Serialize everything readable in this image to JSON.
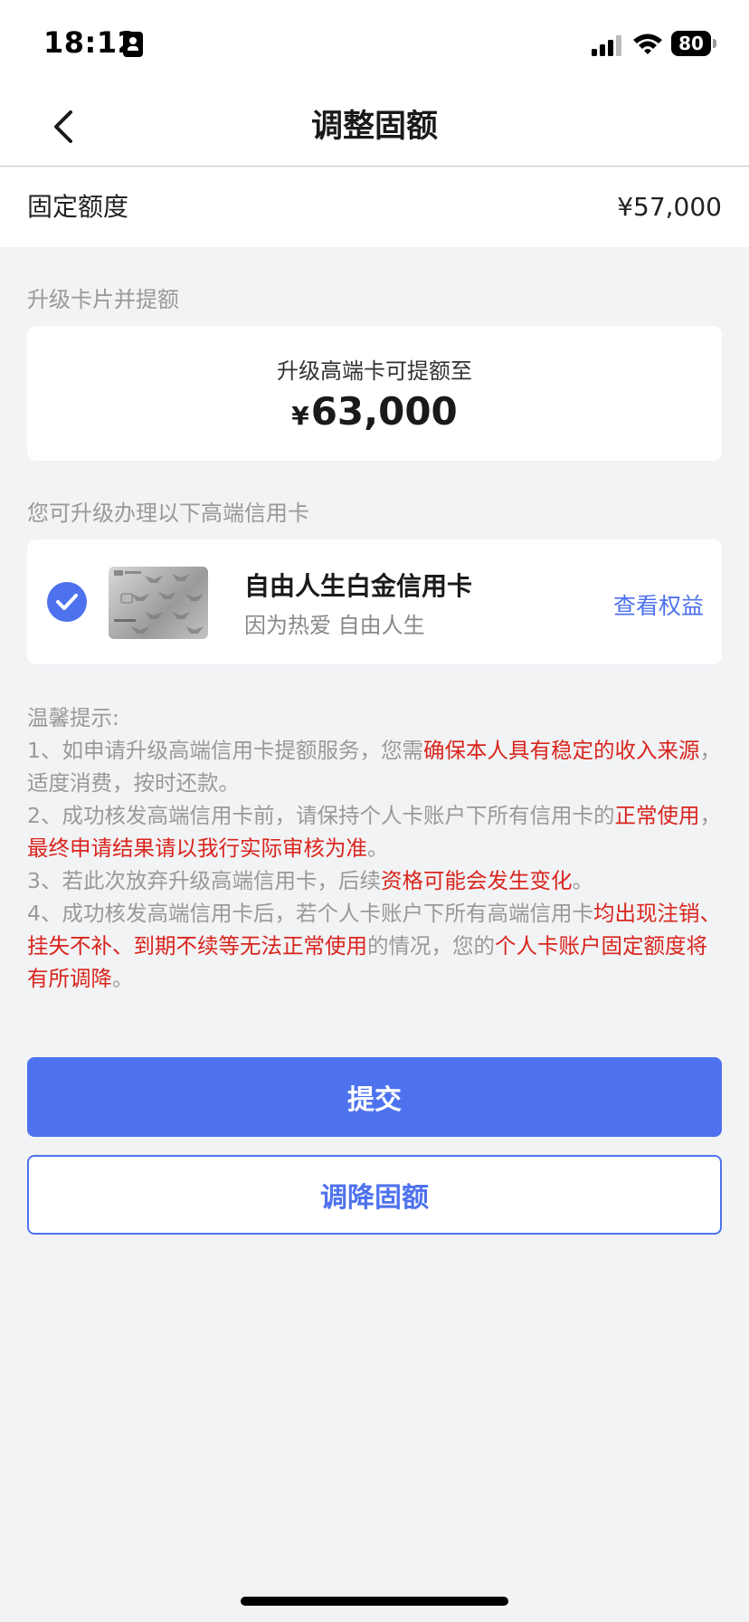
{
  "status_bar": {
    "time": "18:12",
    "battery_level": "80",
    "icons": [
      "contact-card-icon",
      "signal-icon",
      "wifi-icon",
      "battery-icon"
    ]
  },
  "nav": {
    "title": "调整固额",
    "back_icon": "chevron-left-icon"
  },
  "fixed_limit": {
    "label": "固定额度",
    "value": "¥57,000"
  },
  "upgrade_section": {
    "label": "升级卡片并提额",
    "caption": "升级高端卡可提额至",
    "currency": "¥",
    "amount": "63,000"
  },
  "cards_section": {
    "label": "您可升级办理以下高端信用卡",
    "cards": [
      {
        "name": "自由人生白金信用卡",
        "slogan": "因为热爱 自由人生",
        "benefits_link": "查看权益",
        "selected": true
      }
    ]
  },
  "tips": {
    "title": "温馨提示:",
    "items": [
      [
        {
          "text": "1、如申请升级高端信用卡提额服务，您需",
          "red": false
        },
        {
          "text": "确保本人具有稳定的收入来源",
          "red": true
        },
        {
          "text": "，适度消费，按时还款。",
          "red": false
        }
      ],
      [
        {
          "text": "2、成功核发高端信用卡前，请保持个人卡账户下所有信用卡的",
          "red": false
        },
        {
          "text": "正常使用",
          "red": true
        },
        {
          "text": "，",
          "red": false
        },
        {
          "text": "最终申请结果请以我行实际审核为准",
          "red": true
        },
        {
          "text": "。",
          "red": false
        }
      ],
      [
        {
          "text": "3、若此次放弃升级高端信用卡，后续",
          "red": false
        },
        {
          "text": "资格可能会发生变化",
          "red": true
        },
        {
          "text": "。",
          "red": false
        }
      ],
      [
        {
          "text": "4、成功核发高端信用卡后，若个人卡账户下所有高端信用卡",
          "red": false
        },
        {
          "text": "均出现注销、挂失不补、到期不续等无法正常使用",
          "red": true
        },
        {
          "text": "的情况，您的",
          "red": false
        },
        {
          "text": "个人卡账户固定额度将有所调降",
          "red": true
        },
        {
          "text": "。",
          "red": false
        }
      ]
    ]
  },
  "actions": {
    "submit_label": "提交",
    "reduce_label": "调降固额"
  },
  "colors": {
    "accent": "#4e72ee",
    "warning_red": "#d9251d",
    "page_bg": "#f2f3f5"
  }
}
